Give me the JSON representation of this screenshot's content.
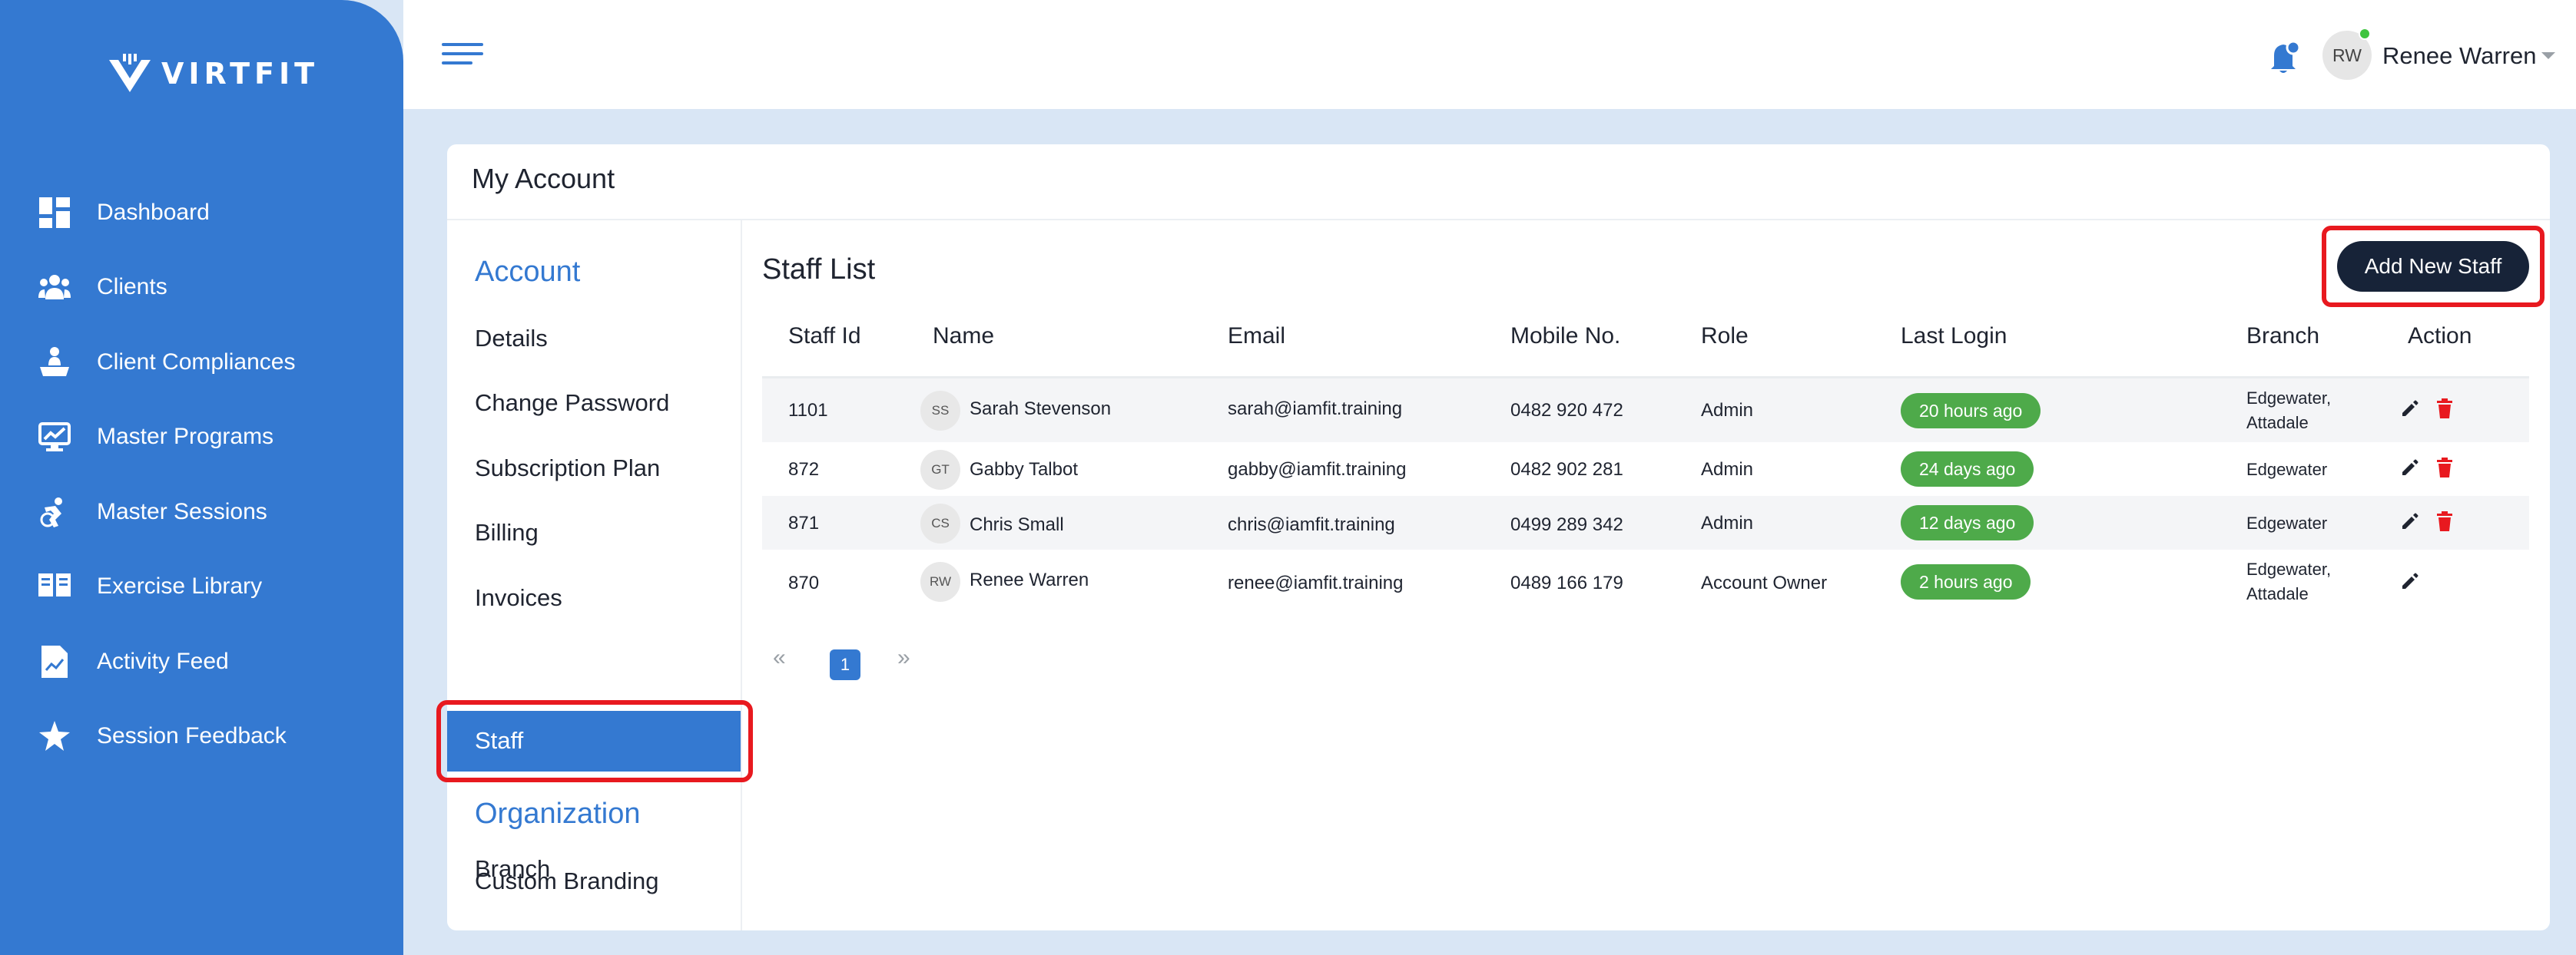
{
  "brand": {
    "name": "VIRTFIT",
    "primary_color": "#3479d1",
    "dark_color": "#172338",
    "alert_color": "#e8191f",
    "success_color": "#4eaa4a"
  },
  "sidebar": {
    "items": [
      {
        "label": "Dashboard",
        "icon": "dashboard-icon"
      },
      {
        "label": "Clients",
        "icon": "users-icon"
      },
      {
        "label": "Client Compliances",
        "icon": "compliance-icon"
      },
      {
        "label": "Master Programs",
        "icon": "programs-icon"
      },
      {
        "label": "Master Sessions",
        "icon": "sessions-icon"
      },
      {
        "label": "Exercise Library",
        "icon": "library-icon"
      },
      {
        "label": "Activity Feed",
        "icon": "activity-icon"
      },
      {
        "label": "Session Feedback",
        "icon": "star-icon"
      }
    ]
  },
  "topbar": {
    "user_initials": "RW",
    "user_name": "Renee Warren"
  },
  "page": {
    "title": "My Account"
  },
  "account_menu": {
    "account_heading": "Account",
    "account_items": [
      "Details",
      "Change Password",
      "Subscription Plan",
      "Billing",
      "Invoices",
      "Staff"
    ],
    "active_item": "Staff",
    "organization_heading": "Organization",
    "organization_items": [
      "Custom Branding",
      "Branch"
    ]
  },
  "staff": {
    "title": "Staff List",
    "add_button": "Add New Staff",
    "columns": [
      "Staff Id",
      "Name",
      "Email",
      "Mobile No.",
      "Role",
      "Last Login",
      "Branch",
      "Action"
    ],
    "rows": [
      {
        "id": "1101",
        "initials": "SS",
        "name": "Sarah Stevenson",
        "email": "sarah@iamfit.training",
        "mobile": "0482 920 472",
        "role": "Admin",
        "last_login": "20 hours ago",
        "branch": [
          "Edgewater,",
          "Attadale"
        ],
        "can_delete": true
      },
      {
        "id": "872",
        "initials": "GT",
        "name": "Gabby Talbot",
        "email": "gabby@iamfit.training",
        "mobile": "0482 902 281",
        "role": "Admin",
        "last_login": "24 days ago",
        "branch": [
          "Edgewater"
        ],
        "can_delete": true
      },
      {
        "id": "871",
        "initials": "CS",
        "name": "Chris Small",
        "email": "chris@iamfit.training",
        "mobile": "0499 289 342",
        "role": "Admin",
        "last_login": "12 days ago",
        "branch": [
          "Edgewater"
        ],
        "can_delete": true
      },
      {
        "id": "870",
        "initials": "RW",
        "name": "Renee Warren",
        "email": "renee@iamfit.training",
        "mobile": "0489 166 179",
        "role": "Account Owner",
        "last_login": "2 hours ago",
        "branch": [
          "Edgewater,",
          "Attadale"
        ],
        "can_delete": false
      }
    ],
    "pagination": {
      "current_page": "1",
      "prev": "«",
      "next": "»"
    }
  }
}
